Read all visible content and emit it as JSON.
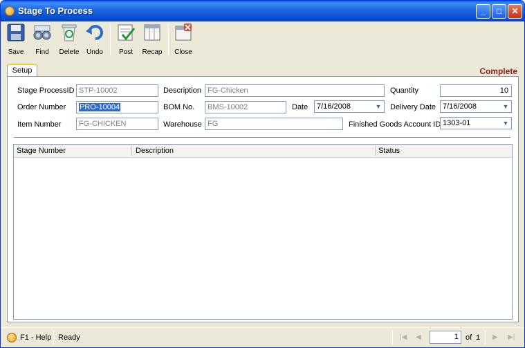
{
  "window": {
    "title": "Stage To Process"
  },
  "toolbar": {
    "save": "Save",
    "find": "Find",
    "delete": "Delete",
    "undo": "Undo",
    "post": "Post",
    "recap": "Recap",
    "close": "Close"
  },
  "tabs": {
    "setup": "Setup"
  },
  "status_text": "Complete",
  "form": {
    "stage_process_id": {
      "label": "Stage ProcessID",
      "value": "STP-10002"
    },
    "description": {
      "label": "Description",
      "value": "FG-Chicken"
    },
    "quantity": {
      "label": "Quantity",
      "value": "10"
    },
    "order_number": {
      "label": "Order Number",
      "value": "PRO-10004"
    },
    "bom_no": {
      "label": "BOM No.",
      "value": "BMS-10002"
    },
    "date": {
      "label": "Date",
      "value": "7/16/2008"
    },
    "delivery_date": {
      "label": "Delivery Date",
      "value": "7/16/2008"
    },
    "item_number": {
      "label": "Item Number",
      "value": "FG-CHICKEN"
    },
    "warehouse": {
      "label": "Warehouse",
      "value": "FG"
    },
    "fg_account": {
      "label": "Finished Goods Account ID",
      "value": "1303-01"
    }
  },
  "grid": {
    "columns": [
      "Stage Number",
      "Description",
      "Status"
    ]
  },
  "statusbar": {
    "help": "F1 - Help",
    "state": "Ready",
    "page": "1",
    "of": "of",
    "total_pages": "1"
  }
}
